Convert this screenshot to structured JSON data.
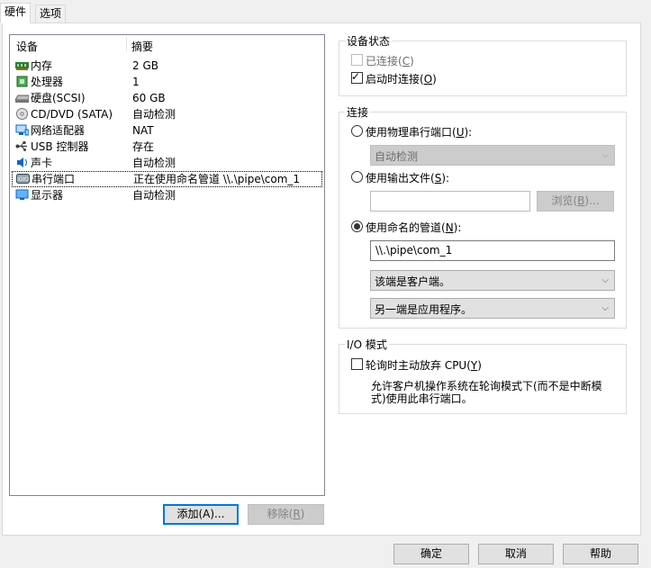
{
  "tabs": [
    {
      "label": "硬件",
      "active": true
    },
    {
      "label": "选项",
      "active": false
    }
  ],
  "device_list": {
    "columns": [
      "设备",
      "摘要"
    ],
    "rows": [
      {
        "name": "内存",
        "summary": "2 GB",
        "icon": "memory-icon"
      },
      {
        "name": "处理器",
        "summary": "1",
        "icon": "processor-icon"
      },
      {
        "name": "硬盘(SCSI)",
        "summary": "60 GB",
        "icon": "hard-disk-icon"
      },
      {
        "name": "CD/DVD (SATA)",
        "summary": "自动检测",
        "icon": "cd-dvd-icon"
      },
      {
        "name": "网络适配器",
        "summary": "NAT",
        "icon": "network-adapter-icon"
      },
      {
        "name": "USB 控制器",
        "summary": "存在",
        "icon": "usb-icon"
      },
      {
        "name": "声卡",
        "summary": "自动检测",
        "icon": "sound-card-icon"
      },
      {
        "name": "串行端口",
        "summary": "正在使用命名管道 \\\\.\\pipe\\com_1",
        "icon": "serial-port-icon",
        "selected": true
      },
      {
        "name": "显示器",
        "summary": "自动检测",
        "icon": "display-icon"
      }
    ]
  },
  "list_buttons": {
    "add": "添加(A)...",
    "remove_text": "移除(",
    "remove_key": "R",
    "remove_end": ")"
  },
  "device_status": {
    "title": "设备状态",
    "connected": {
      "text": "已连接(",
      "key": "C",
      "end": ")",
      "checked": false,
      "disabled": true
    },
    "connect_at_power_on": {
      "text": "启动时连接(",
      "key": "O",
      "end": ")",
      "checked": true
    }
  },
  "connection": {
    "title": "连接",
    "physical_port": {
      "text": "使用物理串行端口(",
      "key": "U",
      "end": "):",
      "selected": false
    },
    "physical_port_value": "自动检测",
    "output_file": {
      "text": "使用输出文件(",
      "key": "S",
      "end": "):",
      "selected": false
    },
    "output_file_value": "",
    "browse": {
      "text": "浏览(",
      "key": "B",
      "end": ")..."
    },
    "named_pipe": {
      "text": "使用命名的管道(",
      "key": "N",
      "end": "):",
      "selected": true
    },
    "pipe_name": "\\\\.\\pipe\\com_1",
    "this_end": "该端是客户端。",
    "other_end": "另一端是应用程序。"
  },
  "io_mode": {
    "title": "I/O 模式",
    "yield_cpu": {
      "text": "轮询时主动放弃 CPU(",
      "key": "Y",
      "end": ")",
      "checked": false
    },
    "description_line1": "允许客户机操作系统在轮询模式下(而不是中断模",
    "description_line2": "式)使用此串行端口。"
  },
  "footer": {
    "ok": "确定",
    "cancel": "取消",
    "help": "帮助"
  }
}
